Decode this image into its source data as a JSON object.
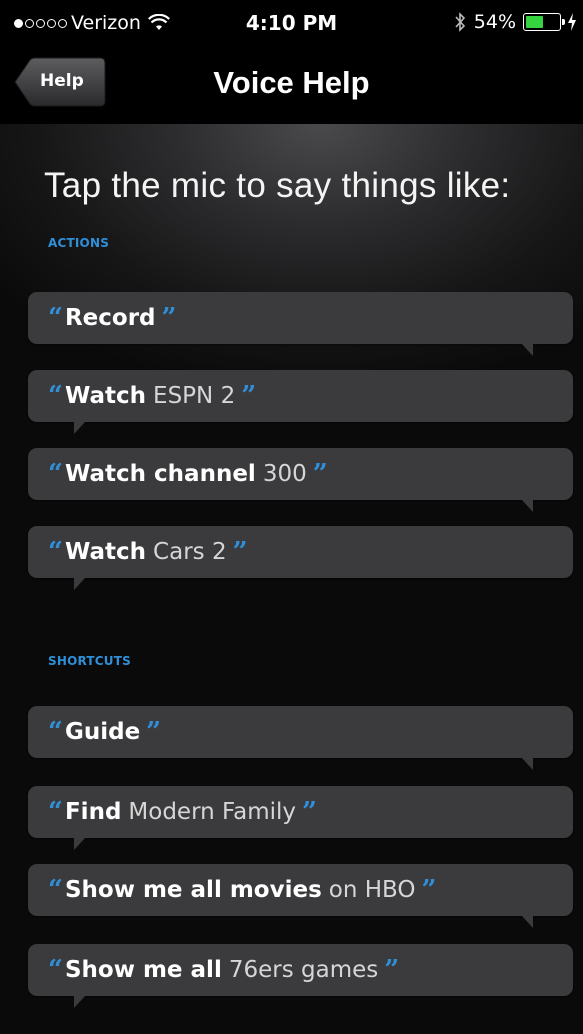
{
  "status_bar": {
    "carrier": "Verizon",
    "time": "4:10 PM",
    "battery": "54%",
    "battery_level": 0.54,
    "battery_color": "#34d33f"
  },
  "nav": {
    "back_label": "Help",
    "title": "Voice Help"
  },
  "headline": "Tap the mic to say things like:",
  "accent_color": "#2f8fd8",
  "sections": {
    "actions": {
      "label": "ACTIONS",
      "items": [
        {
          "bold": "Record",
          "rest": ""
        },
        {
          "bold": "Watch",
          "rest": "ESPN 2"
        },
        {
          "bold": "Watch channel",
          "rest": "300"
        },
        {
          "bold": "Watch",
          "rest": "Cars 2"
        }
      ]
    },
    "shortcuts": {
      "label": "SHORTCUTS",
      "items": [
        {
          "bold": "Guide",
          "rest": ""
        },
        {
          "bold": "Find",
          "rest": "Modern Family"
        },
        {
          "bold": "Show me all movies",
          "rest": "on HBO"
        },
        {
          "bold": "Show me all",
          "rest": "76ers games"
        }
      ]
    }
  }
}
